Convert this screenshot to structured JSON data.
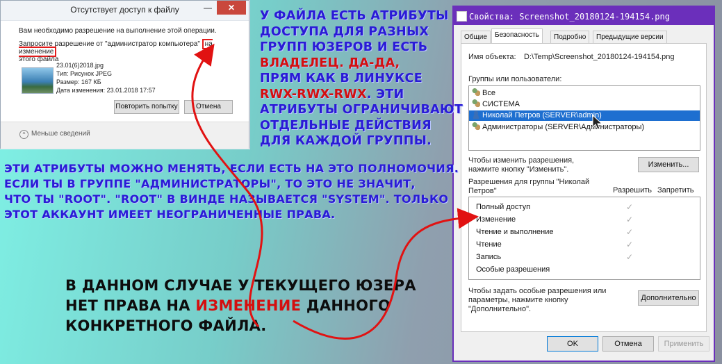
{
  "access_dialog": {
    "title": "Отсутствует доступ к файлу",
    "minimize_glyph": "—",
    "close_glyph": "✕",
    "message": "Вам необходимо разрешение на выполнение этой операции.",
    "request_prefix": "Запросите разрешение от \"администратор компьютера\"",
    "request_highlight": "на изменение",
    "request_suffix": "этого файла",
    "file": {
      "name": "23.01(6)2018.jpg",
      "type": "Тип: Рисунок JPEG",
      "size": "Размер: 167 КБ",
      "modified": "Дата изменения: 23.01.2018 17:57"
    },
    "retry_label": "Повторить попытку",
    "cancel_label": "Отмена",
    "less_details": "Меньше сведений"
  },
  "properties_dialog": {
    "title": "Свойства: Screenshot_20180124-194154.png",
    "tabs": [
      "Общие",
      "Безопасность",
      "Подробно",
      "Предыдущие версии"
    ],
    "object_name_label": "Имя объекта:",
    "object_name_value": "D:\\Temp\\Screenshot_20180124-194154.png",
    "groups_label": "Группы или пользователи:",
    "groups": [
      "Все",
      "СИСТЕМА",
      "Николай Петров (SERVER\\admin)",
      "Администраторы (SERVER\\Администраторы)"
    ],
    "change_hint": "Чтобы изменить разрешения, нажмите кнопку \"Изменить\".",
    "change_button": "Изменить...",
    "perms_label": "Разрешения для группы \"Николай Петров\"",
    "allow_label": "Разрешить",
    "deny_label": "Запретить",
    "permissions": [
      "Полный доступ",
      "Изменение",
      "Чтение и выполнение",
      "Чтение",
      "Запись",
      "Особые разрешения"
    ],
    "allowed_flags": [
      true,
      true,
      true,
      true,
      true,
      false
    ],
    "special_hint": "Чтобы задать особые разрешения или параметры, нажмите кнопку \"Дополнительно\".",
    "advanced_button": "Дополнительно",
    "ok_button": "OK",
    "cancel_button": "Отмена",
    "apply_button": "Применить"
  },
  "annotations": {
    "top_right_lines": [
      "У файла есть атрибуты",
      "доступа для разных",
      "групп юзеров и есть"
    ],
    "owner_line_red": "владелец. Да-да,",
    "linux_line": "прям как в линуксе",
    "rwx_red": "rwx-rwx-rwx",
    "rwx_tail": ". Эти",
    "bottom_right_lines": [
      "атрибуты ограничивают",
      "отдельные действия",
      "для каждой группы."
    ],
    "middle_lines": [
      "Эти атрибуты можно менять, если есть на это полномочия.",
      "Если ты в группе \"Администраторы\", то это не значит,",
      "что ты \"root\". \"Root\" в винде называется \"system\". Только",
      "этот аккаунт имеет неограниченные права."
    ],
    "bottom_line1": "В данном случае у текущего юзера",
    "bottom_line2_prefix": "нет права на ",
    "bottom_line2_red": "изменение",
    "bottom_line2_suffix": " данного",
    "bottom_line3": "конкретного файла."
  },
  "colors": {
    "accent_title": "#6b2fbb",
    "annotation_blue": "#2a1bd6",
    "annotation_red": "#d40f0f",
    "selection": "#1e6fd0"
  }
}
